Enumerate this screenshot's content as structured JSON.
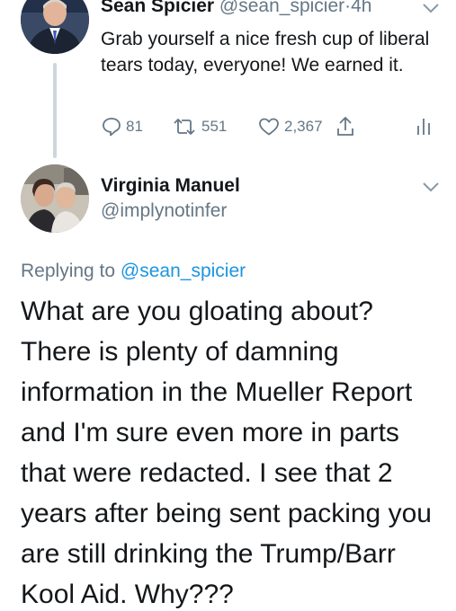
{
  "parent_tweet": {
    "display_name": "Sean Spicier",
    "handle": "@sean_spicier",
    "separator": "·",
    "time": "4h",
    "text": "Grab yourself a nice fresh cup of liberal tears today, everyone! We earned it.",
    "actions": {
      "replies": "81",
      "retweets": "551",
      "likes": "2,367"
    }
  },
  "reply_tweet": {
    "display_name": "Virginia Manuel",
    "handle": "@implynotinfer",
    "replying_prefix": "Replying to",
    "replying_to": "@sean_spicier",
    "text": "What are you gloating about? There is plenty of damning information in the Mueller Report and I'm sure even more in parts that were redacted.  I see that 2 years after being sent packing you are still drinking the Trump/Barr Kool Aid. Why???"
  },
  "colors": {
    "text_primary": "#14171a",
    "text_secondary": "#657786",
    "link": "#1b95e0",
    "thread_line": "#ccd6dd"
  },
  "icons": {
    "reply": "reply-icon",
    "retweet": "retweet-icon",
    "like": "heart-icon",
    "share": "share-icon",
    "analytics": "analytics-icon",
    "menu": "chevron-down-icon"
  }
}
